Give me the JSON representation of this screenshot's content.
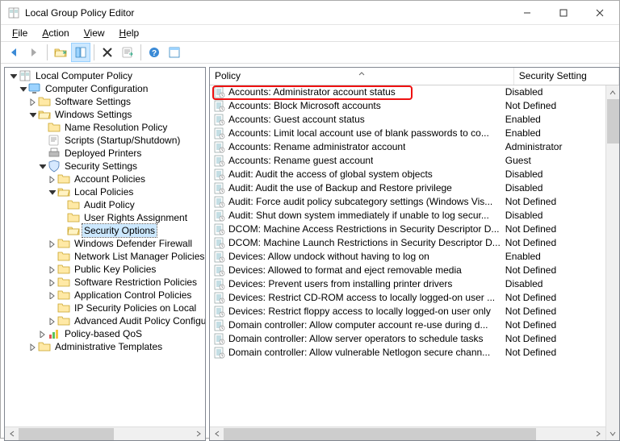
{
  "window": {
    "title": "Local Group Policy Editor"
  },
  "menu": {
    "file": "File",
    "action": "Action",
    "view": "View",
    "help": "Help"
  },
  "tree": {
    "root": "Local Computer Policy",
    "ccfg": "Computer Configuration",
    "sw": "Software Settings",
    "win": "Windows Settings",
    "nrp": "Name Resolution Policy",
    "scripts": "Scripts (Startup/Shutdown)",
    "dep": "Deployed Printers",
    "sec": "Security Settings",
    "acct": "Account Policies",
    "local": "Local Policies",
    "audit": "Audit Policy",
    "ura": "User Rights Assignment",
    "so": "Security Options",
    "wdf": "Windows Defender Firewall",
    "nlmp": "Network List Manager Policies",
    "pkp": "Public Key Policies",
    "srp": "Software Restriction Policies",
    "acp": "Application Control Policies",
    "ipsec": "IP Security Policies on Local",
    "aapc": "Advanced Audit Policy Configuration",
    "qos": "Policy-based QoS",
    "adm": "Administrative Templates"
  },
  "list": {
    "col_policy": "Policy",
    "col_setting": "Security Setting",
    "rows": [
      {
        "policy": "Accounts: Administrator account status",
        "setting": "Disabled"
      },
      {
        "policy": "Accounts: Block Microsoft accounts",
        "setting": "Not Defined"
      },
      {
        "policy": "Accounts: Guest account status",
        "setting": "Enabled"
      },
      {
        "policy": "Accounts: Limit local account use of blank passwords to co...",
        "setting": "Enabled"
      },
      {
        "policy": "Accounts: Rename administrator account",
        "setting": "Administrator"
      },
      {
        "policy": "Accounts: Rename guest account",
        "setting": "Guest"
      },
      {
        "policy": "Audit: Audit the access of global system objects",
        "setting": "Disabled"
      },
      {
        "policy": "Audit: Audit the use of Backup and Restore privilege",
        "setting": "Disabled"
      },
      {
        "policy": "Audit: Force audit policy subcategory settings (Windows Vis...",
        "setting": "Not Defined"
      },
      {
        "policy": "Audit: Shut down system immediately if unable to log secur...",
        "setting": "Disabled"
      },
      {
        "policy": "DCOM: Machine Access Restrictions in Security Descriptor D...",
        "setting": "Not Defined"
      },
      {
        "policy": "DCOM: Machine Launch Restrictions in Security Descriptor D...",
        "setting": "Not Defined"
      },
      {
        "policy": "Devices: Allow undock without having to log on",
        "setting": "Enabled"
      },
      {
        "policy": "Devices: Allowed to format and eject removable media",
        "setting": "Not Defined"
      },
      {
        "policy": "Devices: Prevent users from installing printer drivers",
        "setting": "Disabled"
      },
      {
        "policy": "Devices: Restrict CD-ROM access to locally logged-on user ...",
        "setting": "Not Defined"
      },
      {
        "policy": "Devices: Restrict floppy access to locally logged-on user only",
        "setting": "Not Defined"
      },
      {
        "policy": "Domain controller: Allow computer account re-use during d...",
        "setting": "Not Defined"
      },
      {
        "policy": "Domain controller: Allow server operators to schedule tasks",
        "setting": "Not Defined"
      },
      {
        "policy": "Domain controller: Allow vulnerable Netlogon secure chann...",
        "setting": "Not Defined"
      }
    ]
  }
}
